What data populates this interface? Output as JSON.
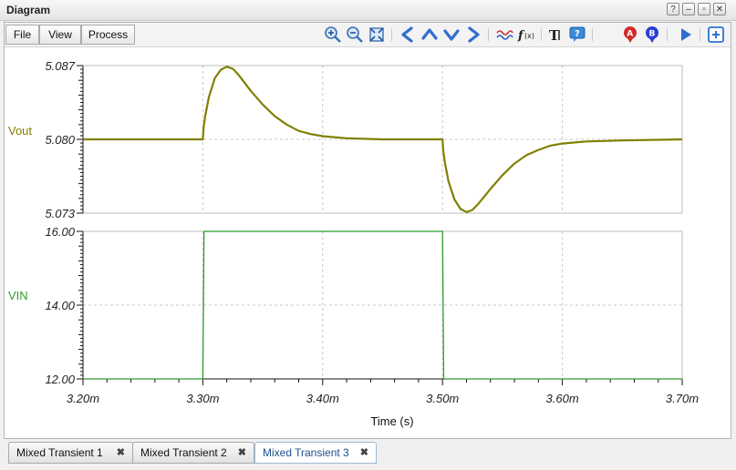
{
  "window": {
    "title": "Diagram",
    "help_label": "?",
    "min_label": "–",
    "max_label": "▫",
    "close_label": "✕"
  },
  "menu": {
    "file": "File",
    "view": "View",
    "process": "Process"
  },
  "toolbar_icons": [
    "zoom-in-icon",
    "zoom-out-icon",
    "zoom-fit-icon",
    "arrow-left-icon",
    "arrow-up-icon",
    "arrow-down-icon",
    "arrow-right-icon",
    "waveform-icon",
    "function-icon",
    "text-icon",
    "help-comment-icon",
    "cursor-a-icon",
    "cursor-b-icon",
    "run-icon",
    "add-icon"
  ],
  "tabs": [
    {
      "label": "Mixed Transient 1",
      "close": "✖",
      "active": false
    },
    {
      "label": "Mixed Transient 2",
      "close": "✖",
      "active": false
    },
    {
      "label": "Mixed Transient 3",
      "close": "✖",
      "active": true
    }
  ],
  "colors": {
    "vout": "#808000",
    "vin": "#2e9b2e",
    "grid": "#c8c8c8"
  },
  "chart_data": [
    {
      "type": "line",
      "title": "",
      "ylabel": "Vout",
      "xlabel": "",
      "xlim": [
        3.2,
        3.7
      ],
      "ylim": [
        5.073,
        5.087
      ],
      "yticks": [
        "5.087",
        "5.080",
        "5.073"
      ],
      "grid": true,
      "series": [
        {
          "name": "Vout",
          "points": [
            [
              3.2,
              5.08
            ],
            [
              3.3,
              5.08
            ],
            [
              3.3005,
              5.081
            ],
            [
              3.302,
              5.0822
            ],
            [
              3.305,
              5.084
            ],
            [
              3.31,
              5.0858
            ],
            [
              3.315,
              5.0866
            ],
            [
              3.32,
              5.0869
            ],
            [
              3.325,
              5.0867
            ],
            [
              3.33,
              5.0861
            ],
            [
              3.34,
              5.0846
            ],
            [
              3.35,
              5.0833
            ],
            [
              3.36,
              5.0822
            ],
            [
              3.37,
              5.0814
            ],
            [
              3.38,
              5.0808
            ],
            [
              3.39,
              5.0805
            ],
            [
              3.4,
              5.0803
            ],
            [
              3.42,
              5.0801
            ],
            [
              3.45,
              5.08
            ],
            [
              3.5,
              5.08
            ],
            [
              3.5005,
              5.079
            ],
            [
              3.502,
              5.0778
            ],
            [
              3.505,
              5.076
            ],
            [
              3.51,
              5.0743
            ],
            [
              3.515,
              5.0734
            ],
            [
              3.52,
              5.0731
            ],
            [
              3.525,
              5.0733
            ],
            [
              3.53,
              5.0739
            ],
            [
              3.54,
              5.0753
            ],
            [
              3.55,
              5.0766
            ],
            [
              3.56,
              5.0777
            ],
            [
              3.57,
              5.0785
            ],
            [
              3.58,
              5.079
            ],
            [
              3.59,
              5.0794
            ],
            [
              3.6,
              5.0796
            ],
            [
              3.62,
              5.0798
            ],
            [
              3.65,
              5.0799
            ],
            [
              3.7,
              5.08
            ]
          ]
        }
      ]
    },
    {
      "type": "line",
      "title": "",
      "ylabel": "VIN",
      "xlabel": "Time (s)",
      "xlim": [
        3.2,
        3.7
      ],
      "ylim": [
        12,
        16
      ],
      "yticks": [
        "16.00",
        "14.00",
        "12.00"
      ],
      "xticks": [
        "3.20m",
        "3.30m",
        "3.40m",
        "3.50m",
        "3.60m",
        "3.70m"
      ],
      "grid": true,
      "series": [
        {
          "name": "VIN",
          "points": [
            [
              3.2,
              12
            ],
            [
              3.3,
              12
            ],
            [
              3.301,
              16
            ],
            [
              3.5,
              16
            ],
            [
              3.501,
              12
            ],
            [
              3.7,
              12
            ]
          ]
        }
      ]
    }
  ]
}
